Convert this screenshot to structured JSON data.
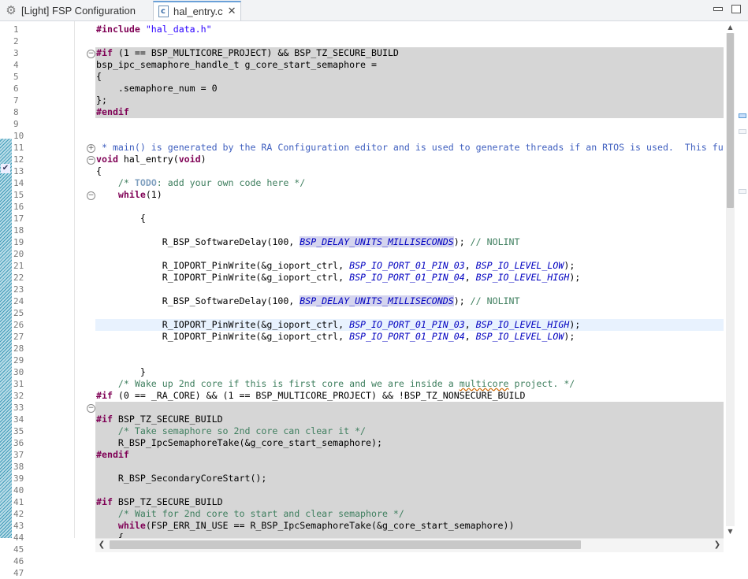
{
  "tabs": [
    {
      "label": "[Light] FSP Configuration",
      "icon": "gear-icon",
      "active": false
    },
    {
      "label": "hal_entry.c",
      "icon": "c-file-icon",
      "active": true,
      "close_glyph": "✕"
    }
  ],
  "window_buttons": {
    "minimize": "minimize",
    "maximize": "maximize"
  },
  "ruler": {
    "change_marker": "✔"
  },
  "editor": {
    "first_line_number": 1,
    "current_line": 26,
    "lines": [
      "#include \"hal_data.h\"",
      "",
      "#if (1 == BSP_MULTICORE_PROJECT) && BSP_TZ_SECURE_BUILD",
      "bsp_ipc_semaphore_handle_t g_core_start_semaphore =",
      "{",
      "    .semaphore_num = 0",
      "};",
      "#endif",
      "",
      "",
      " * main() is generated by the RA Configuration editor and is used to generate threads if an RTOS is used.  This function is called by main() when no RTOS is used.",
      "void hal_entry(void)",
      "{",
      "    /* TODO: add your own code here */",
      "    while(1)",
      "",
      "        {",
      "",
      "            R_BSP_SoftwareDelay(100, BSP_DELAY_UNITS_MILLISECONDS); // NOLINT",
      "",
      "            R_IOPORT_PinWrite(&g_ioport_ctrl, BSP_IO_PORT_01_PIN_03, BSP_IO_LEVEL_LOW);",
      "            R_IOPORT_PinWrite(&g_ioport_ctrl, BSP_IO_PORT_01_PIN_04, BSP_IO_LEVEL_HIGH);",
      "",
      "            R_BSP_SoftwareDelay(100, BSP_DELAY_UNITS_MILLISECONDS); // NOLINT",
      "",
      "            R_IOPORT_PinWrite(&g_ioport_ctrl, BSP_IO_PORT_01_PIN_03, BSP_IO_LEVEL_HIGH);",
      "            R_IOPORT_PinWrite(&g_ioport_ctrl, BSP_IO_PORT_01_PIN_04, BSP_IO_LEVEL_LOW);",
      "",
      "",
      "        }",
      "    /* Wake up 2nd core if this is first core and we are inside a multicore project. */",
      "#if (0 == _RA_CORE) && (1 == BSP_MULTICORE_PROJECT) && !BSP_TZ_NONSECURE_BUILD",
      "",
      "#if BSP_TZ_SECURE_BUILD",
      "    /* Take semaphore so 2nd core can clear it */",
      "    R_BSP_IpcSemaphoreTake(&g_core_start_semaphore);",
      "#endif",
      "",
      "    R_BSP_SecondaryCoreStart();",
      "",
      "#if BSP_TZ_SECURE_BUILD",
      "    /* Wait for 2nd core to start and clear semaphore */",
      "    while(FSP_ERR_IN_USE == R_BSP_IpcSemaphoreTake(&g_core_start_semaphore))",
      "    {",
      "        ;",
      "    }"
    ],
    "inactive_lines": [
      3,
      4,
      5,
      6,
      7,
      8,
      33,
      34,
      35,
      36,
      37,
      38,
      39,
      40,
      41,
      42,
      43,
      44,
      45,
      46,
      47
    ],
    "fold_expand_lines": [
      11
    ],
    "fold_collapse_lines": [
      3,
      12,
      15,
      33
    ],
    "line_numbers_shown": [
      1,
      2,
      3,
      4,
      5,
      6,
      7,
      8,
      9,
      10,
      11,
      12,
      13,
      14,
      15,
      16,
      17,
      18,
      19,
      20,
      21,
      22,
      23,
      24,
      25,
      26,
      27,
      28,
      29,
      30,
      31,
      32,
      33,
      34,
      35,
      36,
      37,
      38,
      39,
      40,
      41,
      42,
      43,
      44,
      45,
      46,
      47
    ]
  },
  "colors": {
    "keyword": "#7f0055",
    "string": "#2a00ff",
    "comment": "#3f7f5f",
    "macro": "#0000c0",
    "inactive_bg": "#d6d6d6",
    "current_line_bg": "#e8f2fe",
    "tab_accent": "#6aa0d8"
  },
  "scrollbars": {
    "vertical_position": 0,
    "vertical_visible_fraction": 0.35,
    "horizontal_position": 0.0,
    "horizontal_visible_fraction": 0.77,
    "arrows": {
      "up": "▲",
      "down": "▼",
      "left": "❮",
      "right": "❯"
    }
  }
}
